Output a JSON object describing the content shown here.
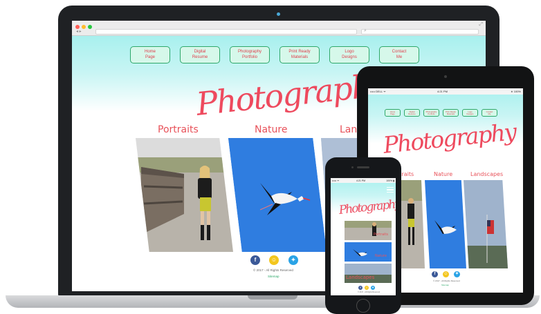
{
  "site": {
    "nav": [
      {
        "line1": "Home",
        "line2": "Page"
      },
      {
        "line1": "Digital",
        "line2": "Resume"
      },
      {
        "line1": "Photography",
        "line2": "Portfolio"
      },
      {
        "line1": "Print Ready",
        "line2": "Materials"
      },
      {
        "line1": "Logo",
        "line2": "Designs"
      },
      {
        "line1": "Contact",
        "line2": "Me"
      }
    ],
    "title": "Photography",
    "categories": {
      "portraits": "Portraits",
      "nature": "Nature",
      "landscapes": "Landscapes",
      "landscapes_cut": "Land",
      "portraits_cut": "rtraits"
    },
    "copyright": "© 2017 - All Rights Reserved",
    "sitemap": "Sitemap"
  },
  "tablet": {
    "carrier": "••••• DELL ᯤ",
    "time": "4:21 PM",
    "battery": "∗ 100%"
  },
  "phone": {
    "carrier": "••••• ᯤ",
    "time": "4:21 PM",
    "battery": "100% ▮"
  },
  "icons": [
    "facebook-icon",
    "snapchat-icon",
    "twitter-icon",
    "hamburger-menu-icon"
  ],
  "colors": {
    "accent_red": "#ee4a5e",
    "nav_border": "#2ea86a",
    "nav_fill": "#d6f8ea",
    "header_gradient_top": "#a8f0ee",
    "nature_blue": "#2f7de0"
  }
}
